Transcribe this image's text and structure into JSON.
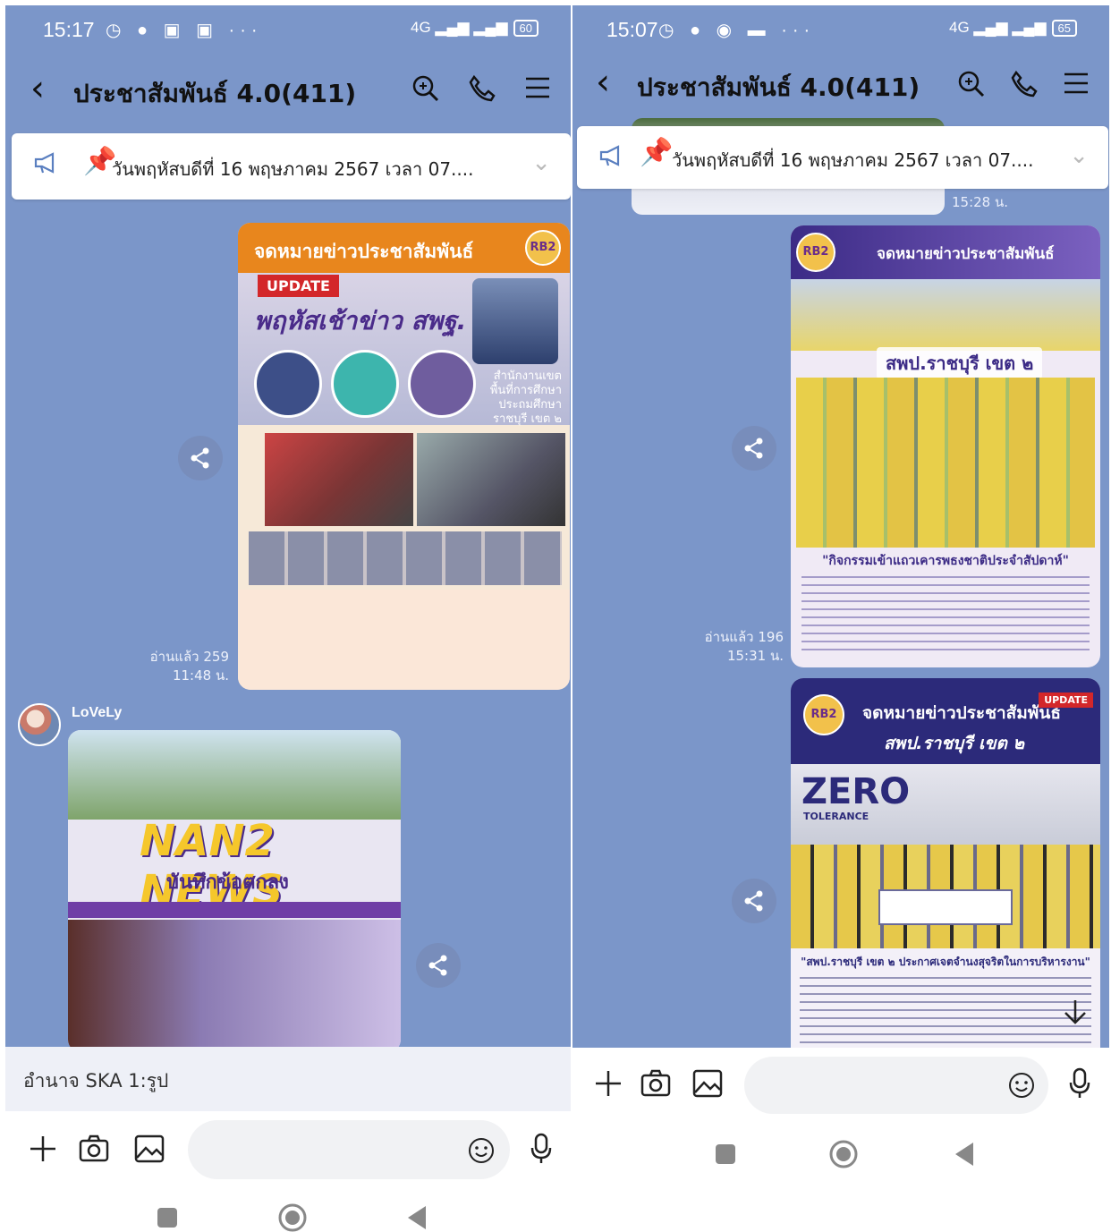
{
  "left": {
    "status": {
      "time": "15:17",
      "battery": "60",
      "signal": "4G"
    },
    "header": {
      "title": "ประชาสัมพันธ์ 4.0(411)"
    },
    "pinned": {
      "text": "วันพฤหัสบดีที่ 16 พฤษภาคม 2567 เวลา 07...."
    },
    "card1": {
      "heading": "จดหมายข่าวประชาสัมพันธ์",
      "badge": "UPDATE",
      "subtitle": "พฤหัสเช้าข่าว สพฐ.",
      "office": "สำนักงานเขตพื้นที่การศึกษาประถมศึกษาราชบุรี เขต ๒"
    },
    "card1_meta": {
      "read": "อ่านแล้ว 259",
      "time": "11:48 น."
    },
    "sender": {
      "name": "LoVeLy"
    },
    "card2": {
      "brand": "NAN2 NEWS",
      "headline": "บันทึกข้อตกลง"
    },
    "typing": "อำนาจ SKA 1:รูป",
    "input_placeholder": ""
  },
  "right": {
    "status": {
      "time": "15:07",
      "battery": "65",
      "signal": "4G"
    },
    "header": {
      "title": "ประชาสัมพันธ์ 4.0(411)"
    },
    "pinned": {
      "text": "วันพฤหัสบดีที่ 16 พฤษภาคม 2567 เวลา 07...."
    },
    "prev_time": "15:28 น.",
    "card1": {
      "heading": "จดหมายข่าวประชาสัมพันธ์",
      "subtitle": "สพป.ราชบุรี เขต ๒",
      "caption": "\"กิจกรรมเข้าแถวเคารพธงชาติประจำสัปดาห์\""
    },
    "card1_meta": {
      "read": "อ่านแล้ว 196",
      "time": "15:31 น."
    },
    "card2": {
      "heading": "จดหมายข่าวประชาสัมพันธ์",
      "badge": "UPDATE",
      "subtitle": "สพป.ราชบุรี เขต ๒",
      "zero": "ZERO",
      "tolerance": "TOLERANCE",
      "caption": "\"สพป.ราชบุรี เขต ๒ ประกาศเจตจำนงสุจริตในการบริหารงาน\""
    },
    "input_placeholder": ""
  }
}
